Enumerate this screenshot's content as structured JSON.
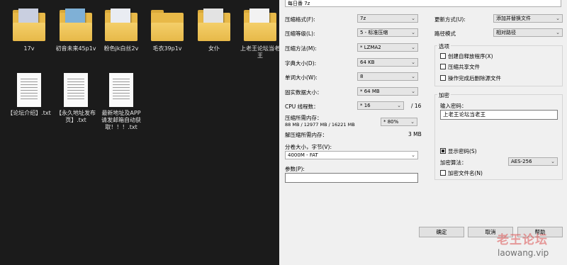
{
  "explorer": {
    "folders": [
      {
        "label": "17v"
      },
      {
        "label": "初音未来45p1v"
      },
      {
        "label": "粉色jk白丝2v"
      },
      {
        "label": "毛衣39p1v"
      },
      {
        "label": "女仆"
      },
      {
        "label": "上老王论坛当老王"
      }
    ],
    "files": [
      {
        "label": "【论坛介绍】.txt"
      },
      {
        "label": "【永久地址发布页】.txt"
      },
      {
        "label": "最新地址及APP请发邮箱自动获取！！！.txt"
      }
    ]
  },
  "dialog": {
    "archive_name": "每日番 7z",
    "format_label": "压缩格式(F):",
    "format_value": "7z",
    "level_label": "压缩等级(L):",
    "level_value": "5 - 标准压缩",
    "method_label": "压缩方法(M):",
    "method_value": "* LZMA2",
    "dict_label": "字典大小(D):",
    "dict_value": "64 KB",
    "word_label": "单词大小(W):",
    "word_value": "8",
    "solid_label": "固实数据大小：",
    "solid_value": "* 64 MB",
    "threads_label": "CPU 线程数：",
    "threads_value": "* 16",
    "threads_total": "/ 16",
    "mem_compress_label": "压缩所需内存：",
    "mem_compress_value": "88 MB / 12977 MB / 16221 MB",
    "mem_percent": "* 80%",
    "mem_decompress_label": "解压缩所需内存：",
    "mem_decompress_value": "3 MB",
    "split_label": "分卷大小，字节(V):",
    "split_value": "4000M - FAT",
    "params_label": "参数(P):",
    "params_value": "",
    "update_label": "更新方式(U):",
    "update_value": "添加并替换文件",
    "path_label": "路径模式",
    "path_value": "相对路径",
    "options_title": "选项",
    "opt_sfx": "创建自释放程序(X)",
    "opt_shared": "压缩共享文件",
    "opt_delete": "操作完成后删除源文件",
    "enc_title": "加密",
    "pwd_label": "输入密码：",
    "pwd_value": "上老王论坛当老王",
    "show_pwd": "显示密码(S)",
    "enc_method_label": "加密算法：",
    "enc_method_value": "AES-256",
    "enc_names": "加密文件名(N)",
    "ok": "确定",
    "cancel": "取消",
    "help": "帮助"
  },
  "watermark": {
    "cn": "老王论坛",
    "url": "laowang.vip"
  }
}
